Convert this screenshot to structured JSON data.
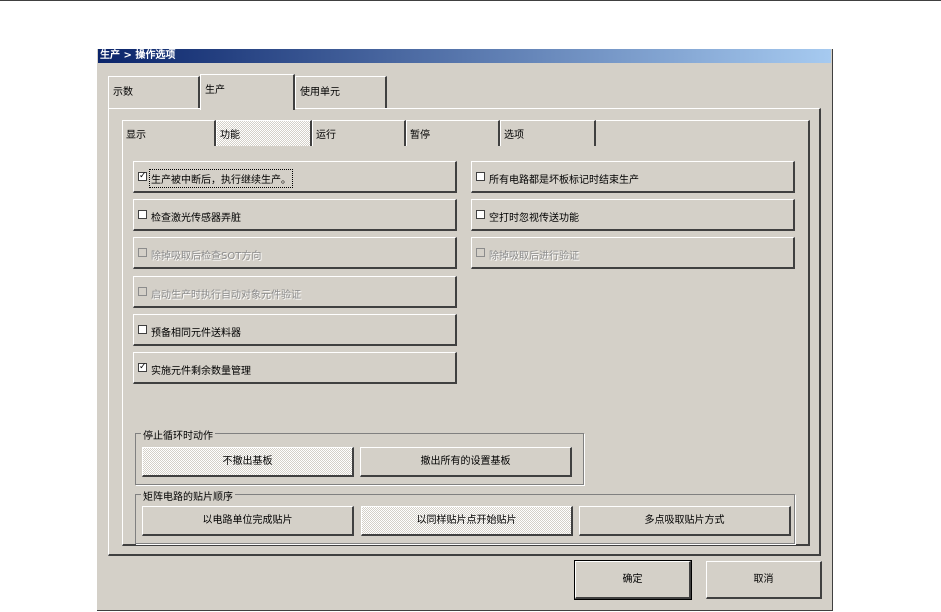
{
  "window": {
    "title": "生产 > 操作选项"
  },
  "main_tabs": [
    {
      "label": "示数"
    },
    {
      "label": "生产"
    },
    {
      "label": "使用单元"
    }
  ],
  "sub_tabs": [
    {
      "label": "显示"
    },
    {
      "label": "功能"
    },
    {
      "label": "运行"
    },
    {
      "label": "暂停"
    },
    {
      "label": "选项"
    }
  ],
  "options": {
    "resume_after_interrupt": {
      "label": "生产被中断后，执行继续生产。",
      "checked": true
    },
    "end_on_bad_mark": {
      "label": "所有电路都是坏板标记时结束生产",
      "checked": false
    },
    "check_laser_dirty": {
      "label": "检查激光传感器弄脏",
      "checked": false
    },
    "ignore_feed_on_empty": {
      "label": "空打时忽视传送功能",
      "checked": false
    },
    "check_sot_after_recovery": {
      "label": "除掉吸取后检查SOT方向",
      "checked": false
    },
    "verify_after_recovery": {
      "label": "除掉吸取后进行验证",
      "checked": false
    },
    "auto_verify_on_start": {
      "label": "启动生产时执行自动对象元件验证",
      "checked": false
    },
    "backup_feeder": {
      "label": "预备相同元件送料器",
      "checked": false
    },
    "remaining_qty_mgmt": {
      "label": "实施元件剩余数量管理",
      "checked": true
    }
  },
  "stop_cycle": {
    "legend": "停止循环时动作",
    "no_unload": "不撤出基板",
    "unload_all": "撤出所有的设置基板"
  },
  "placement_order": {
    "legend": "矩阵电路的贴片顺序",
    "by_circuit": "以电路单位完成贴片",
    "by_same_point": "以同样贴片点开始贴片",
    "multi_pick": "多点吸取贴片方式"
  },
  "footer": {
    "ok": "确定",
    "cancel": "取消"
  }
}
